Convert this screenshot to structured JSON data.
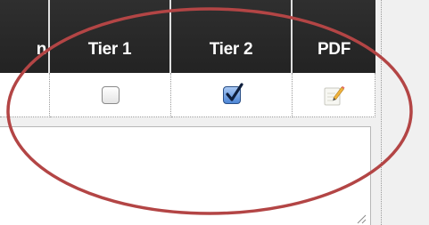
{
  "table": {
    "columns": [
      {
        "label": "n"
      },
      {
        "label": "Tier 1"
      },
      {
        "label": "Tier 2"
      },
      {
        "label": "PDF"
      }
    ],
    "row": {
      "tier1_checked": false,
      "tier2_checked": true,
      "pdf_icon": "pdf-edit-icon"
    }
  },
  "annotation": {
    "shape": "ellipse",
    "color": "#b34545"
  },
  "colors": {
    "header_bg": "#282828",
    "header_text": "#ffffff",
    "checkbox_checked": "#4d86d6",
    "background": "#f0f0f0"
  }
}
